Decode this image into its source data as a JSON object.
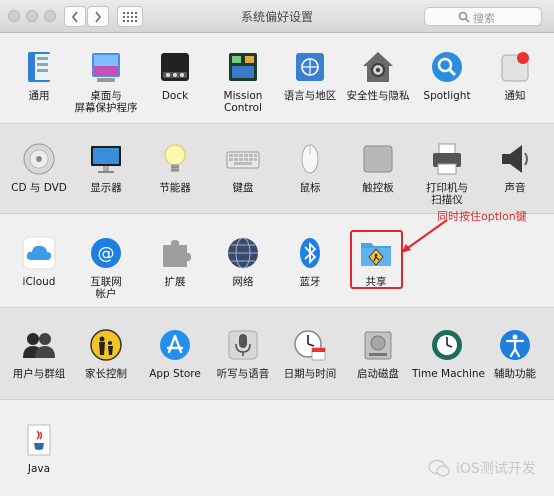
{
  "window": {
    "title": "系统偏好设置"
  },
  "search": {
    "placeholder": "搜索"
  },
  "rows": [
    [
      {
        "name": "general",
        "label": "通用"
      },
      {
        "name": "desktop-screensaver",
        "label": "桌面与\n屏幕保护程序"
      },
      {
        "name": "dock",
        "label": "Dock"
      },
      {
        "name": "mission-control",
        "label": "Mission\nControl"
      },
      {
        "name": "language-region",
        "label": "语言与地区"
      },
      {
        "name": "security-privacy",
        "label": "安全性与隐私"
      },
      {
        "name": "spotlight",
        "label": "Spotlight"
      },
      {
        "name": "notifications",
        "label": "通知"
      }
    ],
    [
      {
        "name": "cd-dvd",
        "label": "CD 与 DVD"
      },
      {
        "name": "displays",
        "label": "显示器"
      },
      {
        "name": "energy-saver",
        "label": "节能器"
      },
      {
        "name": "keyboard",
        "label": "键盘"
      },
      {
        "name": "mouse",
        "label": "鼠标"
      },
      {
        "name": "trackpad",
        "label": "触控板"
      },
      {
        "name": "printers-scanners",
        "label": "打印机与\n扫描仪"
      },
      {
        "name": "sound",
        "label": "声音"
      }
    ],
    [
      {
        "name": "icloud",
        "label": "iCloud"
      },
      {
        "name": "internet-accounts",
        "label": "互联网\n帐户"
      },
      {
        "name": "extensions",
        "label": "扩展"
      },
      {
        "name": "network",
        "label": "网络"
      },
      {
        "name": "bluetooth",
        "label": "蓝牙"
      },
      {
        "name": "sharing",
        "label": "共享"
      }
    ],
    [
      {
        "name": "users-groups",
        "label": "用户与群组"
      },
      {
        "name": "parental-controls",
        "label": "家长控制"
      },
      {
        "name": "app-store",
        "label": "App Store"
      },
      {
        "name": "dictation-speech",
        "label": "听写与语音"
      },
      {
        "name": "date-time",
        "label": "日期与时间"
      },
      {
        "name": "startup-disk",
        "label": "启动磁盘"
      },
      {
        "name": "time-machine",
        "label": "Time Machine"
      },
      {
        "name": "accessibility",
        "label": "辅助功能"
      }
    ],
    [
      {
        "name": "java",
        "label": "Java"
      }
    ]
  ],
  "annotation": {
    "text": "同时按住option键",
    "color": "#e0282a"
  },
  "watermark": {
    "text": "iOS测试开发"
  },
  "icons": {
    "general": "general-icon",
    "desktop-screensaver": "desktop-icon",
    "dock": "dock-icon",
    "mission-control": "mission-control-icon",
    "language-region": "un-flag-icon",
    "security-privacy": "house-lock-icon",
    "spotlight": "magnifier-icon",
    "notifications": "notification-icon",
    "cd-dvd": "disc-icon",
    "displays": "monitor-icon",
    "energy-saver": "bulb-icon",
    "keyboard": "keyboard-icon",
    "mouse": "mouse-icon",
    "trackpad": "trackpad-icon",
    "printers-scanners": "printer-icon",
    "sound": "speaker-icon",
    "icloud": "cloud-icon",
    "internet-accounts": "at-icon",
    "extensions": "puzzle-icon",
    "network": "globe-icon",
    "bluetooth": "bluetooth-icon",
    "sharing": "sharing-folder-icon",
    "users-groups": "users-icon",
    "parental-controls": "parental-icon",
    "app-store": "app-store-icon",
    "dictation-speech": "microphone-icon",
    "date-time": "clock-calendar-icon",
    "startup-disk": "disk-icon",
    "time-machine": "time-machine-icon",
    "accessibility": "accessibility-icon",
    "java": "java-icon"
  }
}
